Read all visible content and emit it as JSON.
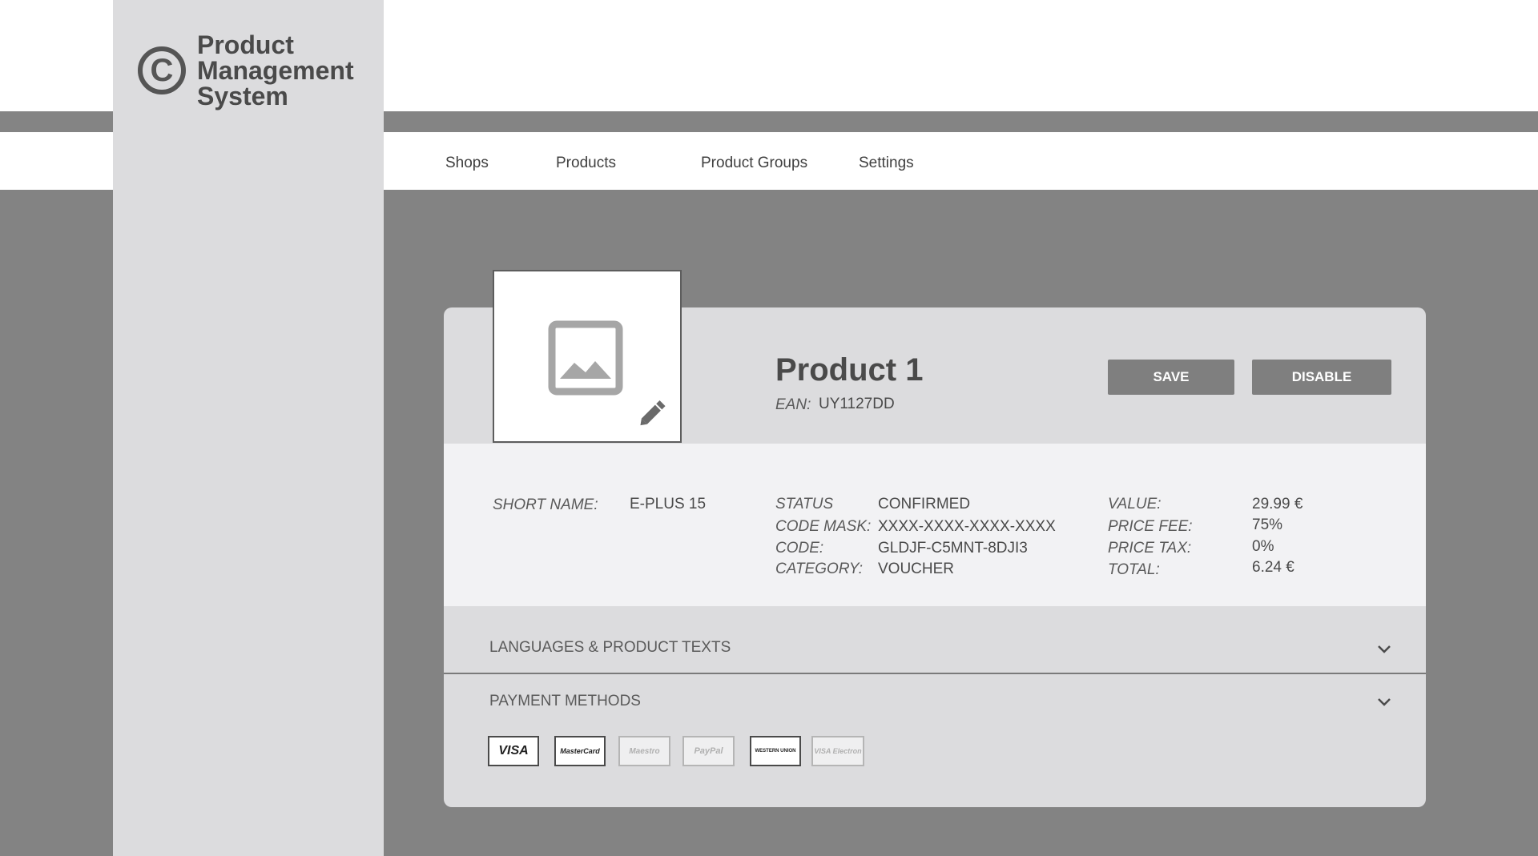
{
  "app": {
    "logo_symbol": "C",
    "title_line1": "Product",
    "title_line2": "Management",
    "title_line3": "System"
  },
  "nav": [
    {
      "label": "Shops"
    },
    {
      "label": "Products"
    },
    {
      "label": "Product Groups"
    },
    {
      "label": "Settings"
    }
  ],
  "product": {
    "title": "Product 1",
    "ean_label": "EAN:",
    "ean_value": "UY1127DD",
    "image_icon": "image-placeholder-icon",
    "edit_icon": "pencil-icon"
  },
  "buttons": {
    "save": "SAVE",
    "disable": "DISABLE"
  },
  "details": {
    "short_name_label": "SHORT NAME:",
    "short_name_value": "E-PLUS 15",
    "status_label": "STATUS",
    "status_value": "CONFIRMED",
    "code_mask_label": "CODE MASK:",
    "code_mask_value": "XXXX-XXXX-XXXX-XXXX",
    "code_label": "CODE:",
    "code_value": "GLDJF-C5MNT-8DJI3",
    "category_label": "CATEGORY:",
    "category_value": "VOUCHER",
    "value_label": "VALUE:",
    "value_value": "29.99 €",
    "price_fee_label": "PRICE FEE:",
    "price_fee_value": "75%",
    "price_tax_label": "PRICE TAX:",
    "price_tax_value": "0%",
    "total_label": "TOTAL:",
    "total_value": "6.24 €"
  },
  "sections": {
    "languages": "LANGUAGES & PRODUCT TEXTS",
    "payment": "PAYMENT METHODS"
  },
  "payment_methods": [
    {
      "label": "VISA",
      "enabled": true
    },
    {
      "label": "MasterCard",
      "enabled": true
    },
    {
      "label": "Maestro",
      "enabled": false
    },
    {
      "label": "PayPal",
      "enabled": false
    },
    {
      "label": "WESTERN UNION",
      "enabled": true
    },
    {
      "label": "VISA Electron",
      "enabled": false
    }
  ],
  "colors": {
    "background": "#838383",
    "sidebar": "#dcdcde",
    "card": "#dcdcde",
    "details_panel": "#f2f2f4",
    "button": "#7f7f7f"
  }
}
